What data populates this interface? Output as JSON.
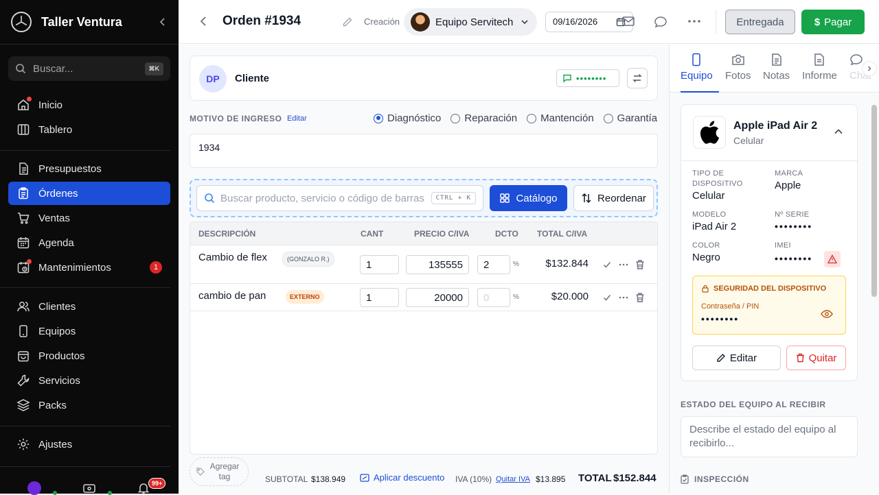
{
  "sidebar": {
    "brand": "Taller Ventura",
    "search_placeholder": "Buscar...",
    "search_shortcut": "⌘K",
    "items": [
      {
        "label": "Inicio",
        "icon": "home-icon"
      },
      {
        "label": "Tablero",
        "icon": "board-icon"
      },
      {
        "label": "Presupuestos",
        "icon": "document-icon"
      },
      {
        "label": "Órdenes",
        "icon": "clipboard-icon"
      },
      {
        "label": "Ventas",
        "icon": "cart-icon"
      },
      {
        "label": "Agenda",
        "icon": "calendar-icon"
      },
      {
        "label": "Mantenimientos",
        "icon": "maintenance-icon",
        "badge": "1"
      },
      {
        "label": "Clientes",
        "icon": "users-icon"
      },
      {
        "label": "Equipos",
        "icon": "phone-icon"
      },
      {
        "label": "Productos",
        "icon": "bag-icon"
      },
      {
        "label": "Servicios",
        "icon": "wrench-icon"
      },
      {
        "label": "Packs",
        "icon": "layers-icon"
      },
      {
        "label": "Ajustes",
        "icon": "gear-icon"
      }
    ],
    "notifications_badge": "99+"
  },
  "header": {
    "title": "Orden #1934",
    "creation_label": "Creación",
    "team_name": "Equipo Servitech",
    "date": "09/16/2026",
    "status_button": "Entregada",
    "pay_button": "Pagar"
  },
  "client": {
    "initials": "DP",
    "name": "Cliente",
    "phone_masked": "••••••••"
  },
  "motivo": {
    "label": "MOTIVO DE INGRESO",
    "edit": "Editar",
    "options": [
      "Diagnóstico",
      "Reparación",
      "Mantención",
      "Garantía"
    ],
    "selected": "Diagnóstico",
    "text": "1934"
  },
  "product_search": {
    "placeholder": "Buscar producto, servicio o código de barras",
    "shortcut": "CTRL + K",
    "catalog_button": "Catálogo",
    "reorder_button": "Reordenar"
  },
  "table": {
    "headers": [
      "DESCRIPCIÓN",
      "CANT",
      "PRECIO C/IVA",
      "DCTO",
      "TOTAL C/IVA"
    ],
    "rows": [
      {
        "description": "Cambio de flex",
        "tag": "(GONZALO R.)",
        "qty": "1",
        "price": "135555",
        "discount": "2",
        "pct": "%",
        "total": "$132.844"
      },
      {
        "description": "cambio de pan",
        "tag": "EXTERNO",
        "qty": "1",
        "price": "20000",
        "discount_placeholder": "0",
        "pct": "%",
        "total": "$20.000"
      }
    ]
  },
  "footer": {
    "add_tag": "Agregar tag",
    "subtotal_label": "SUBTOTAL",
    "subtotal": "$138.949",
    "discount_link": "Aplicar descuento",
    "iva_label": "IVA (10%)",
    "remove_iva": "Quitar IVA",
    "iva": "$13.895",
    "total_label": "TOTAL",
    "total": "$152.844"
  },
  "right_panel": {
    "tabs": [
      "Equipo",
      "Fotos",
      "Notas",
      "Informe",
      "Chat"
    ],
    "active_tab": "Equipo",
    "device": {
      "name": "Apple iPad Air 2",
      "type": "Celular",
      "fields": {
        "type_label": "TIPO DE DISPOSITIVO",
        "type_value": "Celular",
        "brand_label": "MARCA",
        "brand_value": "Apple",
        "model_label": "MODELO",
        "model_value": "iPad Air 2",
        "serial_label": "Nº SERIE",
        "serial_value": "••••••••",
        "color_label": "COLOR",
        "color_value": "Negro",
        "imei_label": "IMEI",
        "imei_value": "••••••••"
      },
      "security": {
        "title": "SEGURIDAD DEL DISPOSITIVO",
        "pin_label": "Contraseña / PIN",
        "pin_value": "••••••••"
      },
      "edit_button": "Editar",
      "remove_button": "Quitar"
    },
    "estado_label": "ESTADO DEL EQUIPO AL RECIBIR",
    "estado_placeholder": "Describe el estado del equipo al recibirlo...",
    "inspection_label": "INSPECCIÓN"
  },
  "colors": {
    "primary": "#1d4ed8",
    "success": "#16a34a",
    "danger": "#dc2626",
    "sidebar_bg": "#0b0b0b"
  }
}
